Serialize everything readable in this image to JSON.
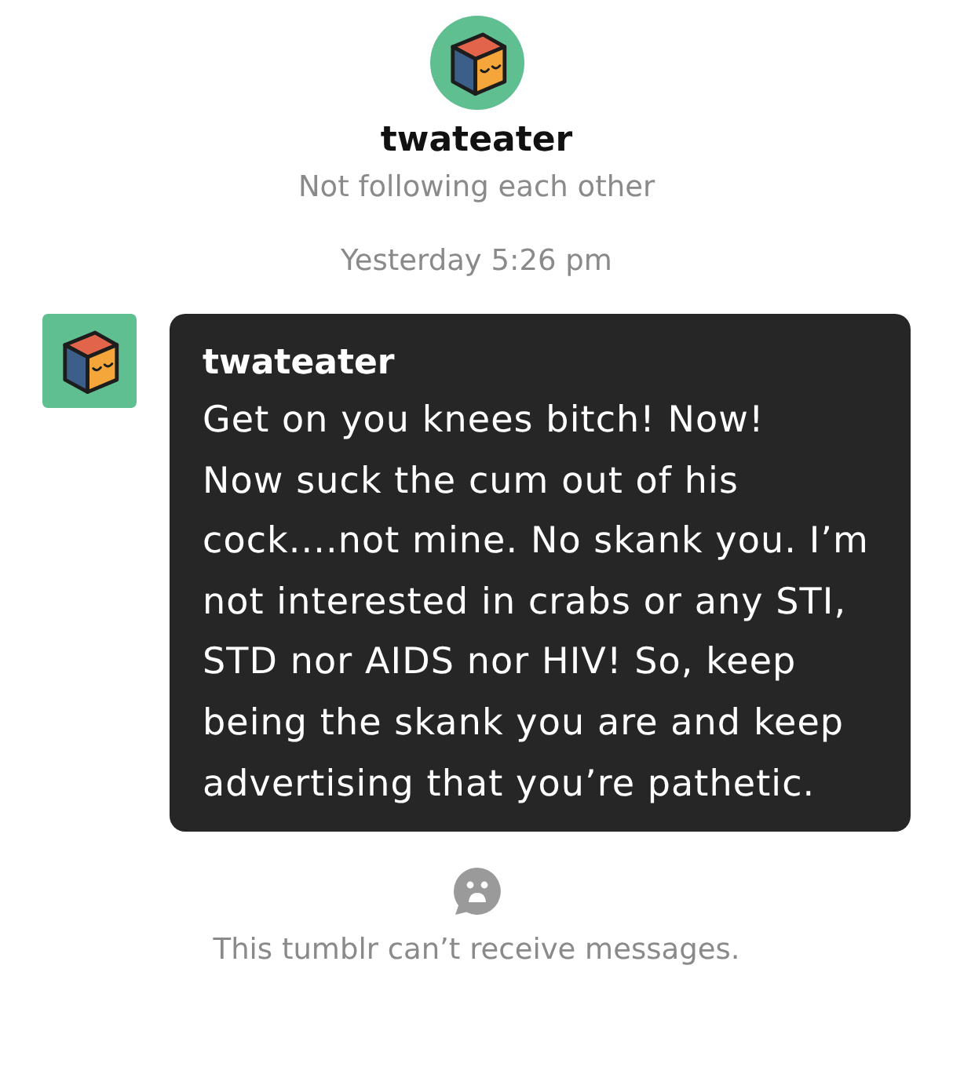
{
  "profile": {
    "username": "twateater",
    "relationship": "Not following each other"
  },
  "timestamp": "Yesterday 5:26 pm",
  "messages": [
    {
      "sender": "twateater",
      "text": "Get on you knees bitch! Now!\nNow suck the cum out of his cock....not mine. No skank you. I’m not interested in crabs or any STI, STD nor AIDS nor HIV! So, keep being the skank you are and keep advertising that you’re pathetic."
    }
  ],
  "notice": "This tumblr can’t receive messages."
}
